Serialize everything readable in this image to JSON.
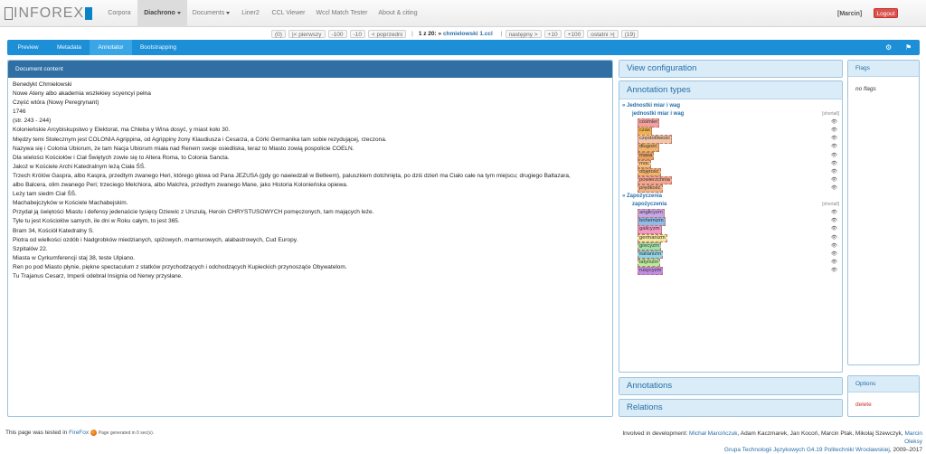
{
  "nav": {
    "logo_text": "INFOREX",
    "items": [
      {
        "label": "Corpora"
      },
      {
        "label": "Diachrono"
      },
      {
        "label": "Documents"
      },
      {
        "label": "Liner2"
      },
      {
        "label": "CCL Viewer"
      },
      {
        "label": "Wccl Match Tester"
      },
      {
        "label": "About & citing"
      }
    ],
    "user": "[Marcin]",
    "logout": "Logout"
  },
  "pager": {
    "count_left": "(0)",
    "first": "|< pierwszy",
    "m100": "-100",
    "m10": "-10",
    "prev": "< poprzedni",
    "position": "1 z 20:",
    "arrow": "»",
    "doc_name": "chmielowski 1.ccl",
    "next": "następny >",
    "p10": "+10",
    "p100": "+100",
    "last": "ostatni >|",
    "count_right": "(19)"
  },
  "tabs": [
    {
      "label": "Preview"
    },
    {
      "label": "Metadata"
    },
    {
      "label": "Annotator"
    },
    {
      "label": "Bootstrapping"
    }
  ],
  "toolbar_icons": {
    "settings": "gear-icon",
    "flag": "flag-icon"
  },
  "document": {
    "title": "Document content",
    "lines": [
      "Benedykt Chmielowski",
      "Nowe Ateny albo akademia wszlekiey scyencyi pełna",
      "Część wtóra (Nowy Peregrynant)",
      "1746",
      "(str. 243 - 244)",
      "Kolonieńskie Arcybiskupstwo y Elektorat, ma Chleba y Wina dosyć, y miast koło 30.",
      "Między temi Stołecznym jest COLONIA Agrippina, od Agrippiny żony Klaudiusza i Cesarza, a Córki Germanika tam sobie rezydującej, rzeczona.",
      "Nazywa się i Colonia Ubiorum, że tam Nacja Ubiorum miała nad Renem swoje osiedliska, teraz to Miasto zowią pospolicie COELN.",
      "Dla wielości Kościołów i Ciał Świętych zowie się to Altera Roma, to Colonia Sancta.",
      "Jakoż w Kościele Archi Katedralnym leżą Ciała ŚŚ.",
      "Trzech Królów Gaspra, albo Kaspra, przedtym zwanego Heri, którego głowa od Pana JEZUSA (gdy go nawiedzali w Betleem), paluszkiem dotchnięta, po dziś dzień ma Ciało całe na tym miejscu; drugiego Baltazara,",
      "albo Balcera, olim zwanego Peri; trzeciego Melchiora, albo Malchra, przedtym zwanego Mane, jako Historia Kolonieńska opiewa.",
      "Leży tam siedm Ciał ŚŚ.",
      "Machabejczyków w Kościele Machabejskim.",
      "Przydał ją świętości Miastu i defensy jedenaście tysięcy Dziewic z Urszulą, Heroin CHRYSTUSOWYCH pomęczonych, tam mających leże.",
      "Tyle tu jest Kościołów samych, ile dni w Roku całym, to jest 365.",
      "Bram 34, Kościół Katedralny S.",
      "Piotra od wielkości ozdób i Nadgrobków miedzianych, spiżowych, marmurowych, alabastrowych, Cud Europy.",
      "Szpitalów 22.",
      "Miasta w Cyrkumferencji staj 38, teste Ulpiano.",
      "Ren po pod Miasto płynie, piękne spectaculum z statków przychodzących i odchodzących Kupieckich przynosząće Obywatelom.",
      "Tu Trajanus Cesarz, Imperii odebrał Insignia od Nerwy przysłane."
    ]
  },
  "sidebar": {
    "view_configuration": "View configuration",
    "annotation_types": "Annotation types",
    "groups": [
      {
        "name": "» Jednostki miar i wag",
        "subset": "jednostki miar i wag",
        "shortcut": "[shortall]",
        "items": [
          {
            "label": "cośmier",
            "color": "#f2a0a0"
          },
          {
            "label": "czas",
            "color": "#f3b24b"
          },
          {
            "label": "częstotliwość",
            "color": "#f3c7a5"
          },
          {
            "label": "długość",
            "color": "#f0b36a"
          },
          {
            "label": "masa",
            "color": "#e7a35d"
          },
          {
            "label": "moc",
            "color": "#f3bf7a"
          },
          {
            "label": "objętość",
            "color": "#f1b46a"
          },
          {
            "label": "powierzchnia",
            "color": "#f5a78e"
          },
          {
            "label": "prędkość",
            "color": "#f1b388"
          }
        ]
      },
      {
        "name": "» Zapożyczenia",
        "subset": "zapożyczenia",
        "shortcut": "[shortall]",
        "items": [
          {
            "label": "anglicyzm",
            "color": "#c9a6ea"
          },
          {
            "label": "bohemizm",
            "color": "#8fbbe8"
          },
          {
            "label": "galicyzm",
            "color": "#f19bc5"
          },
          {
            "label": "germanizm",
            "color": "#f3e79b"
          },
          {
            "label": "grecyzm",
            "color": "#9fe4a6"
          },
          {
            "label": "italianizm",
            "color": "#8fd6e8"
          },
          {
            "label": "latynizm",
            "color": "#b8ec9a"
          },
          {
            "label": "rusycyzm",
            "color": "#c28be4"
          }
        ]
      }
    ],
    "annotations": "Annotations",
    "relations": "Relations"
  },
  "flags": {
    "title": "Flags",
    "empty": "no flags"
  },
  "options": {
    "title": "Options",
    "delete": "delete"
  },
  "footer": {
    "tested_prefix": "This page was tested in",
    "browser": "FireFox",
    "generated": "Page generated in 0 sec(s).",
    "involved": "Involved in development:",
    "dev1": "Michał Marcińczuk",
    "devs_rest": ", Adam Kaczmarek, Jan Kocoń, Marcin Ptak, Mikołaj Szewczyk,",
    "dev2": "Marcin Oleksy",
    "group": "Grupa Technologii Językowych G4.19 Politechniki Wrocławskiej",
    "years": ", 2009–2017"
  }
}
